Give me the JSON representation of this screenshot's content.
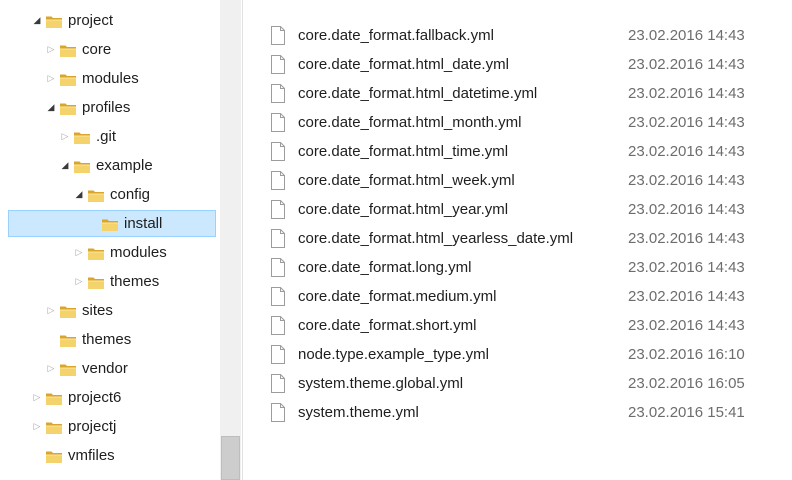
{
  "tree": {
    "items": [
      {
        "label": "project",
        "arrow": "expanded",
        "depth": 2
      },
      {
        "label": "core",
        "arrow": "collapsed",
        "depth": 3
      },
      {
        "label": "modules",
        "arrow": "collapsed",
        "depth": 3
      },
      {
        "label": "profiles",
        "arrow": "expanded",
        "depth": 3
      },
      {
        "label": ".git",
        "arrow": "collapsed",
        "depth": 4
      },
      {
        "label": "example",
        "arrow": "expanded",
        "depth": 4
      },
      {
        "label": "config",
        "arrow": "expanded",
        "depth": 5
      },
      {
        "label": "install",
        "arrow": "none",
        "depth": 6,
        "selected": true
      },
      {
        "label": "modules",
        "arrow": "collapsed",
        "depth": 5
      },
      {
        "label": "themes",
        "arrow": "collapsed",
        "depth": 5
      },
      {
        "label": "sites",
        "arrow": "collapsed",
        "depth": 3
      },
      {
        "label": "themes",
        "arrow": "none",
        "depth": 3
      },
      {
        "label": "vendor",
        "arrow": "collapsed",
        "depth": 3
      },
      {
        "label": "project6",
        "arrow": "collapsed",
        "depth": 2
      },
      {
        "label": "projectj",
        "arrow": "collapsed",
        "depth": 2
      },
      {
        "label": "vmfiles",
        "arrow": "none",
        "depth": 2
      }
    ]
  },
  "files": [
    {
      "name": "core.date_format.fallback.yml",
      "date": "23.02.2016 14:43"
    },
    {
      "name": "core.date_format.html_date.yml",
      "date": "23.02.2016 14:43"
    },
    {
      "name": "core.date_format.html_datetime.yml",
      "date": "23.02.2016 14:43"
    },
    {
      "name": "core.date_format.html_month.yml",
      "date": "23.02.2016 14:43"
    },
    {
      "name": "core.date_format.html_time.yml",
      "date": "23.02.2016 14:43"
    },
    {
      "name": "core.date_format.html_week.yml",
      "date": "23.02.2016 14:43"
    },
    {
      "name": "core.date_format.html_year.yml",
      "date": "23.02.2016 14:43"
    },
    {
      "name": "core.date_format.html_yearless_date.yml",
      "date": "23.02.2016 14:43"
    },
    {
      "name": "core.date_format.long.yml",
      "date": "23.02.2016 14:43"
    },
    {
      "name": "core.date_format.medium.yml",
      "date": "23.02.2016 14:43"
    },
    {
      "name": "core.date_format.short.yml",
      "date": "23.02.2016 14:43"
    },
    {
      "name": "node.type.example_type.yml",
      "date": "23.02.2016 16:10"
    },
    {
      "name": "system.theme.global.yml",
      "date": "23.02.2016 16:05"
    },
    {
      "name": "system.theme.yml",
      "date": "23.02.2016 15:41"
    }
  ],
  "icons": {
    "expanded_arrow": "tree-expanded-arrow-icon",
    "collapsed_arrow": "tree-collapsed-arrow-icon",
    "folder": "folder-icon",
    "file": "file-icon"
  },
  "colors": {
    "selection_bg": "#cce8ff",
    "selection_border": "#99d1ff",
    "folder": "#e8c25a",
    "date_text": "#6d6d6d"
  }
}
